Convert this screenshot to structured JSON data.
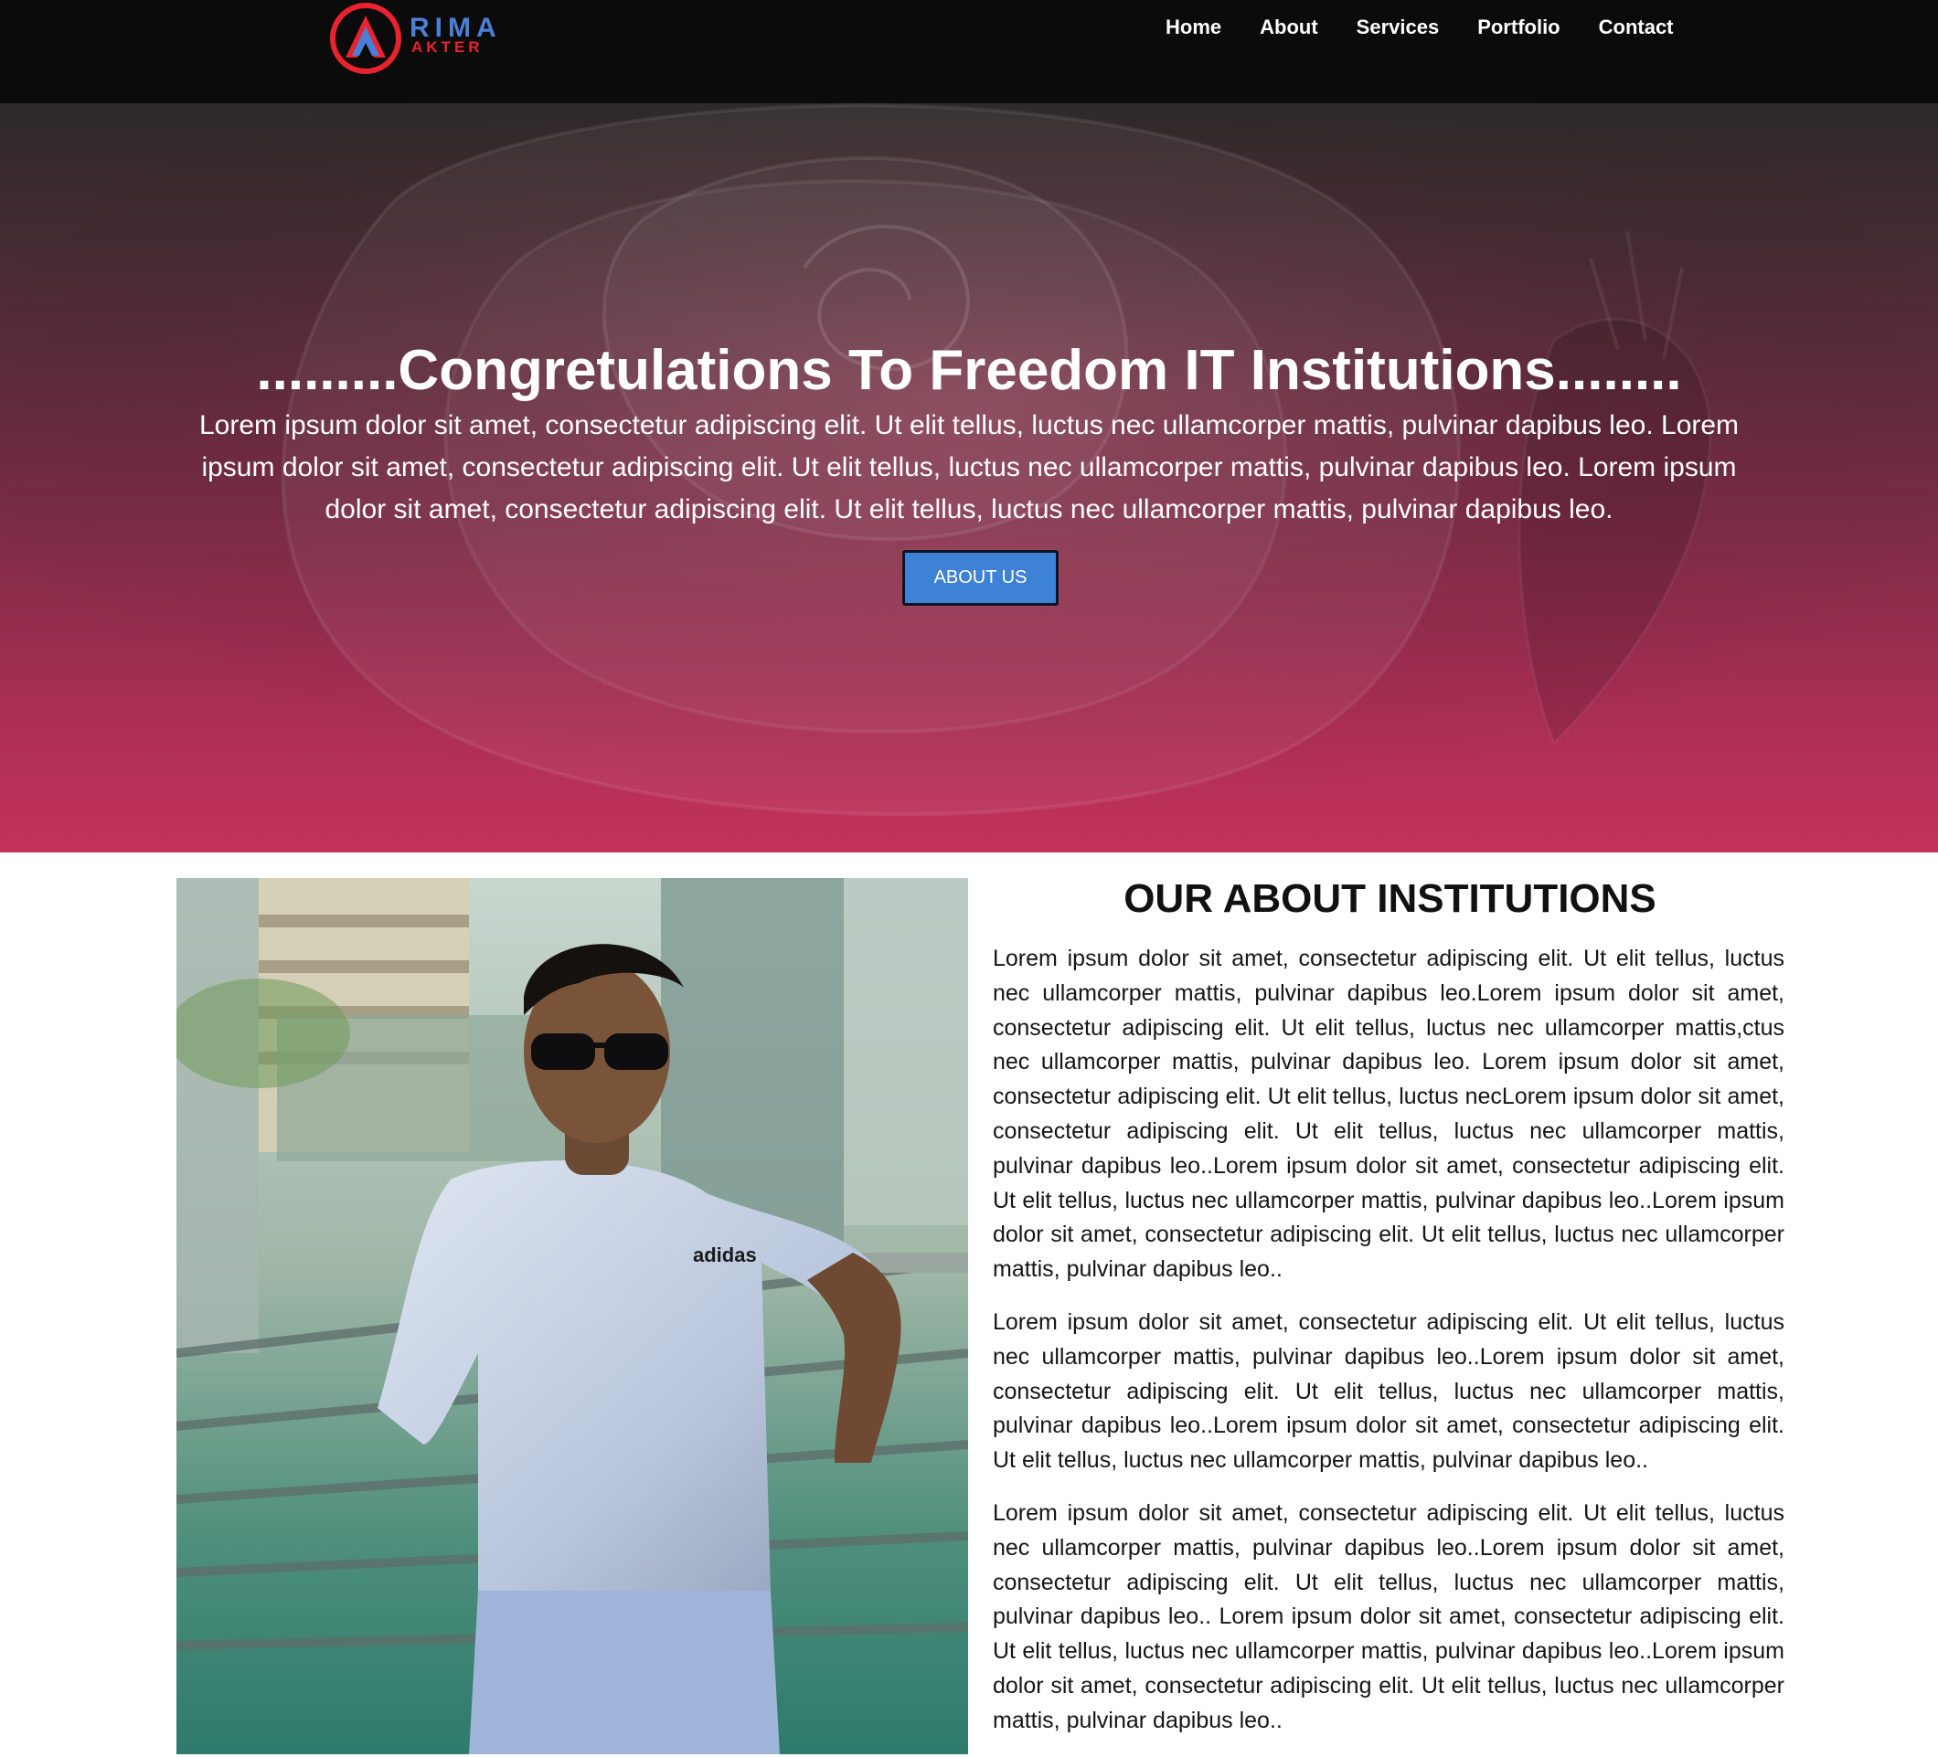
{
  "brand": {
    "logo_word": "RIMA",
    "logo_sub": "AKTER",
    "colors": {
      "logo_red": "#e8232e",
      "logo_blue": "#4a7fd6",
      "nav_bg": "#0b0b0b"
    }
  },
  "nav": {
    "items": [
      {
        "label": "Home"
      },
      {
        "label": "About"
      },
      {
        "label": "Services"
      },
      {
        "label": "Portfolio"
      },
      {
        "label": "Contact"
      }
    ]
  },
  "hero": {
    "title": ".........Congretulations To Freedom IT Institutions........",
    "text": "Lorem ipsum dolor sit amet, consectetur adipiscing elit. Ut elit tellus, luctus nec ullamcorper mattis, pulvinar dapibus leo. Lorem ipsum dolor sit amet, consectetur adipiscing elit. Ut elit tellus, luctus nec ullamcorper mattis, pulvinar dapibus leo. Lorem ipsum dolor sit amet, consectetur adipiscing elit. Ut elit tellus, luctus nec ullamcorper mattis, pulvinar dapibus leo.",
    "button_label": "ABOUT US",
    "colors": {
      "button": "#3d82d4",
      "gradient_bottom": "#c4325b"
    }
  },
  "about": {
    "heading": "OUR ABOUT INSTITUTIONS",
    "paragraphs": [
      "Lorem ipsum dolor sit amet, consectetur adipiscing elit. Ut elit tellus, luctus nec ullamcorper mattis, pulvinar dapibus leo.Lorem ipsum dolor sit amet, consectetur adipiscing elit. Ut elit tellus, luctus nec ullamcorper mattis,ctus nec ullamcorper mattis, pulvinar dapibus leo. Lorem ipsum dolor sit amet, consectetur adipiscing elit. Ut elit tellus, luctus necLorem ipsum dolor sit amet, consectetur adipiscing elit. Ut elit tellus, luctus nec ullamcorper mattis, pulvinar dapibus leo..Lorem ipsum dolor sit amet, consectetur adipiscing elit. Ut elit tellus, luctus nec ullamcorper mattis, pulvinar dapibus leo..Lorem ipsum dolor sit amet, consectetur adipiscing elit. Ut elit tellus, luctus nec ullamcorper mattis, pulvinar dapibus leo..",
      "Lorem ipsum dolor sit amet, consectetur adipiscing elit. Ut elit tellus, luctus nec ullamcorper mattis, pulvinar dapibus leo..Lorem ipsum dolor sit amet, consectetur adipiscing elit. Ut elit tellus, luctus nec ullamcorper mattis, pulvinar dapibus leo..Lorem ipsum dolor sit amet, consectetur adipiscing elit. Ut elit tellus, luctus nec ullamcorper mattis, pulvinar dapibus leo..",
      "Lorem ipsum dolor sit amet, consectetur adipiscing elit. Ut elit tellus, luctus nec ullamcorper mattis, pulvinar dapibus leo..Lorem ipsum dolor sit amet, consectetur adipiscing elit. Ut elit tellus, luctus nec ullamcorper mattis, pulvinar dapibus leo..  Lorem ipsum dolor sit amet, consectetur adipiscing elit. Ut elit tellus, luctus nec ullamcorper mattis, pulvinar dapibus leo..Lorem ipsum dolor sit amet, consectetur adipiscing elit. Ut elit tellus, luctus nec ullamcorper mattis, pulvinar dapibus leo.."
    ],
    "photo_shirt_text": "adidas"
  }
}
